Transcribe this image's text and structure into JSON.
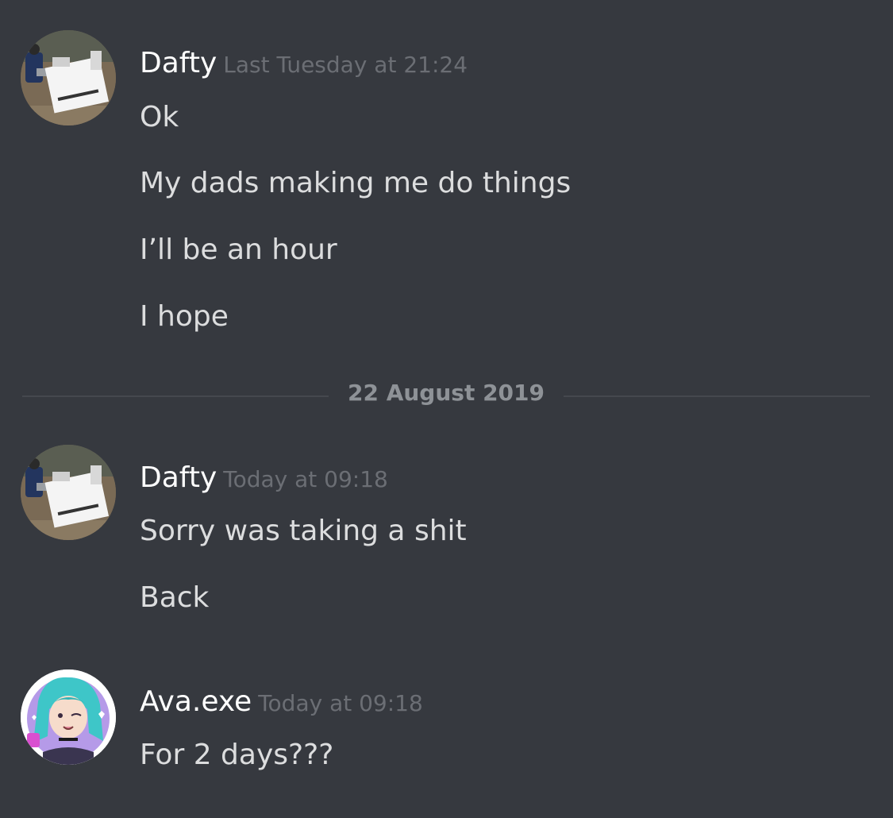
{
  "conversation": {
    "groups": [
      {
        "username": "Dafty",
        "timestamp": "Last Tuesday at 21:24",
        "messages": [
          "Ok",
          "My dads making me do things",
          "I’ll be an hour",
          "I hope"
        ]
      },
      {
        "username": "Dafty",
        "timestamp": "Today at 09:18",
        "messages": [
          "Sorry was taking a shit",
          "Back"
        ]
      },
      {
        "username": "Ava.exe",
        "timestamp": "Today at 09:18",
        "messages": [
          "For 2 days???"
        ]
      }
    ],
    "date_divider": "22 August 2019"
  },
  "colors": {
    "background": "#36393f",
    "username": "#ffffff",
    "timestamp": "#6b6e74",
    "message_text": "#dcddde",
    "divider_text": "#8e9297"
  },
  "icons": {
    "dafty_avatar": "change-my-mind-meme-avatar",
    "ava_avatar": "anime-girl-teal-hair-avatar"
  }
}
